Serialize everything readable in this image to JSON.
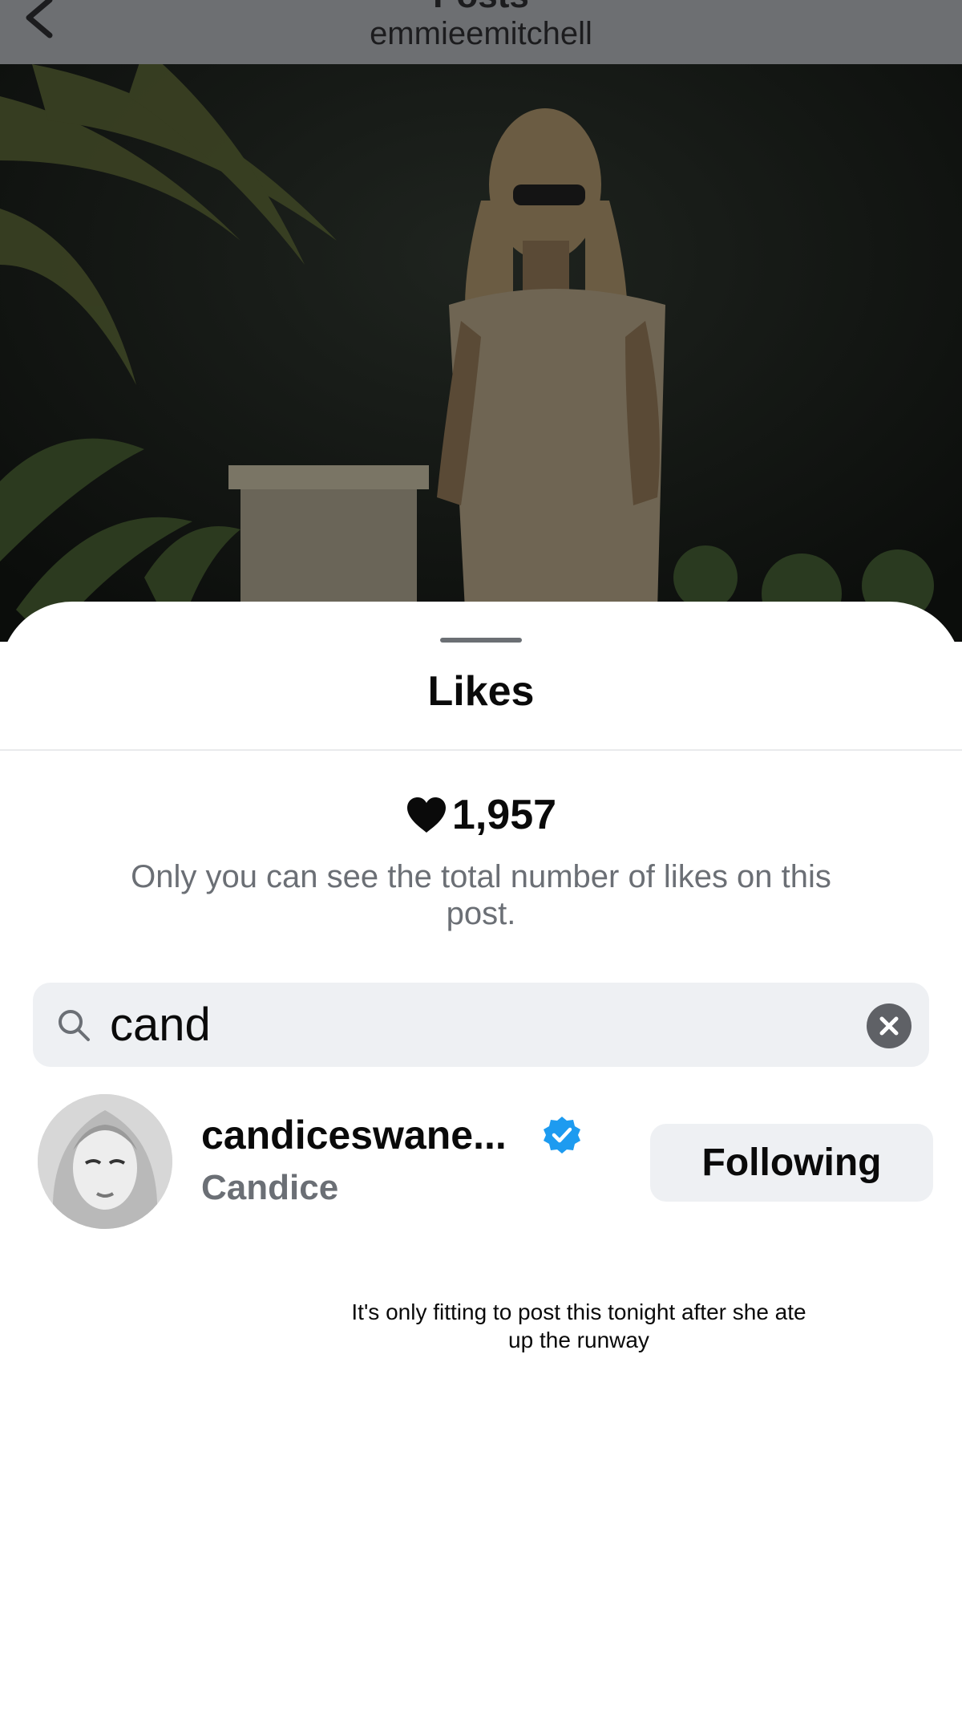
{
  "header": {
    "title": "Posts",
    "username": "emmieemitchell"
  },
  "sheet": {
    "title": "Likes",
    "likes_count": "1,957",
    "likes_note": "Only you can see the total number of likes on this post."
  },
  "search": {
    "value": "cand"
  },
  "results": [
    {
      "username": "candiceswane...",
      "full_name": "Candice",
      "verified": true,
      "button_label": "Following"
    }
  ],
  "caption": "It's only fitting to post this tonight after she ate up the runway",
  "colors": {
    "verified_badge": "#1d9bf0",
    "secondary_text": "#6b6f75",
    "field_background": "#eef0f3"
  },
  "icons": [
    "back-icon",
    "heart-icon",
    "search-icon",
    "clear-icon",
    "verified-icon"
  ]
}
